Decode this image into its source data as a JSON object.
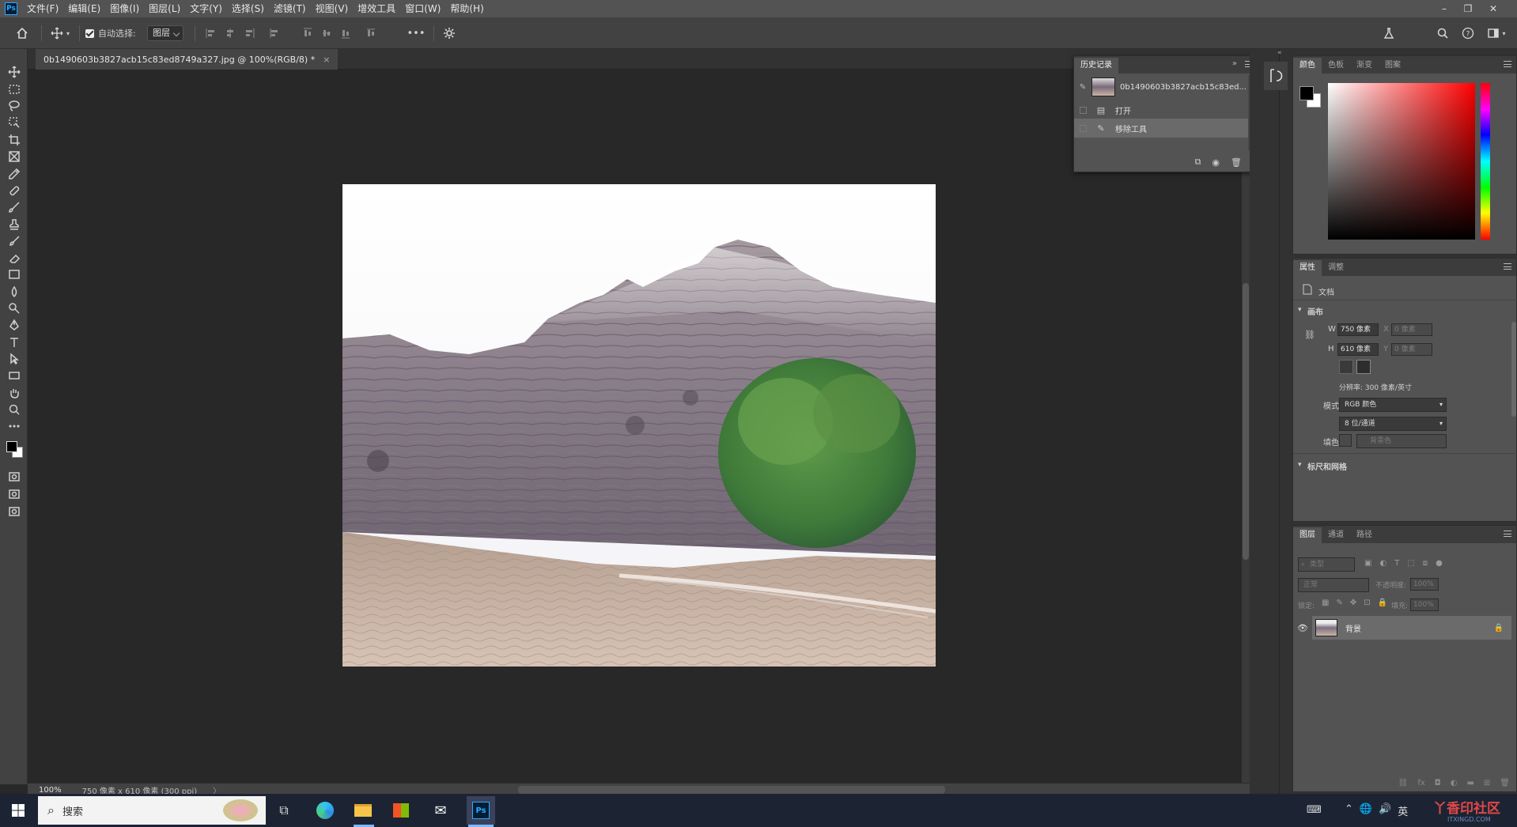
{
  "app": {
    "logo": "Ps",
    "menu": [
      "文件(F)",
      "编辑(E)",
      "图像(I)",
      "图层(L)",
      "文字(Y)",
      "选择(S)",
      "滤镜(T)",
      "视图(V)",
      "增效工具",
      "窗口(W)",
      "帮助(H)"
    ],
    "window_controls": [
      "–",
      "❐",
      "✕"
    ]
  },
  "options_bar": {
    "auto_select_label": "自动选择:",
    "auto_select_checked": true,
    "auto_select_target": "图层",
    "more_label": "•••"
  },
  "document": {
    "tab_title": "0b1490603b3827acb15c83ed8749a327.jpg @ 100%(RGB/8) *",
    "close_glyph": "×"
  },
  "status": {
    "zoom": "100%",
    "info": "750 像素 x 610 像素 (300 ppi)",
    "arrow": "〉"
  },
  "history_panel": {
    "tab": "历史记录",
    "snapshot_name": "0b1490603b3827acb15c83ed...",
    "steps": [
      "打开",
      "移除工具"
    ],
    "active_step": 1
  },
  "color_panel": {
    "tabs": [
      "颜色",
      "色板",
      "渐变",
      "图案"
    ],
    "foreground": "#000000",
    "background": "#ffffff",
    "hue": "#ff0000"
  },
  "properties_panel": {
    "tabs": [
      "属性",
      "调整"
    ],
    "doc_label": "文档",
    "canvas_section": "画布",
    "w_label": "W",
    "w_value": "750 像素",
    "h_label": "H",
    "h_value": "610 像素",
    "x_label": "X",
    "x_value": "0 像素",
    "y_label": "Y",
    "y_value": "0 像素",
    "resolution": "分辨率: 300 像素/英寸",
    "mode_label": "模式",
    "mode_value": "RGB 颜色",
    "depth_value": "8 位/通道",
    "fill_label": "填色",
    "fill_value": "背景色",
    "rulers_section": "标尺和网格"
  },
  "layers_panel": {
    "tabs": [
      "图层",
      "通道",
      "路径"
    ],
    "filter_placeholder": "类型",
    "blend_mode": "正常",
    "opacity_label": "不透明度:",
    "opacity_value": "100%",
    "lock_label": "锁定:",
    "fill_label": "填充:",
    "fill_value": "100%",
    "layers": [
      {
        "name": "背景",
        "visible": true,
        "locked": true
      }
    ]
  },
  "taskbar": {
    "search_label": "搜索",
    "ime_label": "英",
    "watermark": "丫香印社区",
    "watermark_sub": "ITXINGD.COM"
  }
}
